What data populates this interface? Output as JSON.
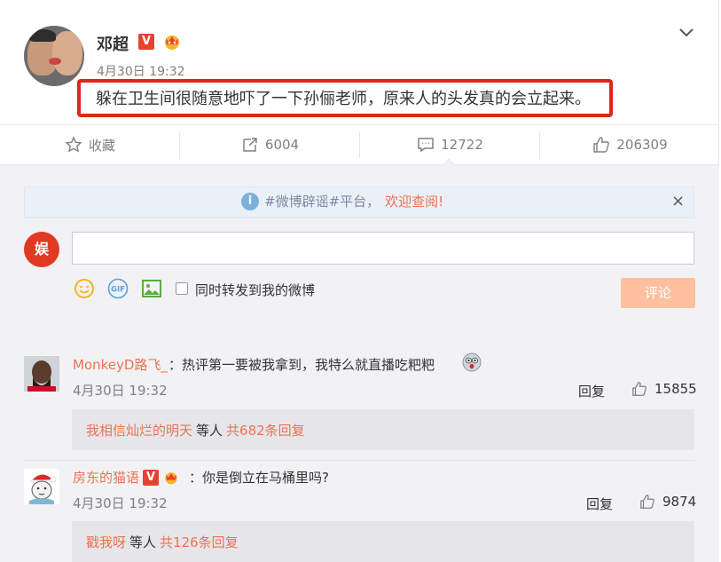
{
  "post": {
    "username": "邓超",
    "verified_badge": "V",
    "time": "4月30日 19:32",
    "text": "躲在卫生间很随意地吓了一下孙俪老师，原来人的头发真的会立起来。"
  },
  "actions": {
    "favorite_label": "收藏",
    "repost_count": "6004",
    "comment_count": "12722",
    "like_count": "206309"
  },
  "notice": {
    "info_icon": "i",
    "prefix": "#微博辟谣#平台，",
    "highlight": "欢迎查阅!",
    "close": "×"
  },
  "composer": {
    "my_avatar_text": "娱",
    "input_value": "",
    "gif_label": "GIF",
    "repost_checkbox_label": "同时转发到我的微博",
    "submit_label": "评论"
  },
  "comments": [
    {
      "name": "MonkeyD路飞_",
      "text": "：热评第一要被我拿到，我特么就直播吃粑粑",
      "time": "4月30日 19:32",
      "reply_label": "回复",
      "likes": "15855",
      "sub_user": "我相信灿烂的明天",
      "sub_mid": "等人",
      "sub_count": "共682条回复"
    },
    {
      "name": "房东的猫语",
      "badge": "V",
      "text": "：你是倒立在马桶里吗?",
      "time": "4月30日 19:32",
      "reply_label": "回复",
      "likes": "9874",
      "sub_user": "戳我呀",
      "sub_mid": "等人",
      "sub_count": "共126条回复"
    }
  ],
  "colors": {
    "accent": "#eb7350",
    "highlight_border": "#e1251b",
    "submit_disabled": "#ffc09f"
  }
}
